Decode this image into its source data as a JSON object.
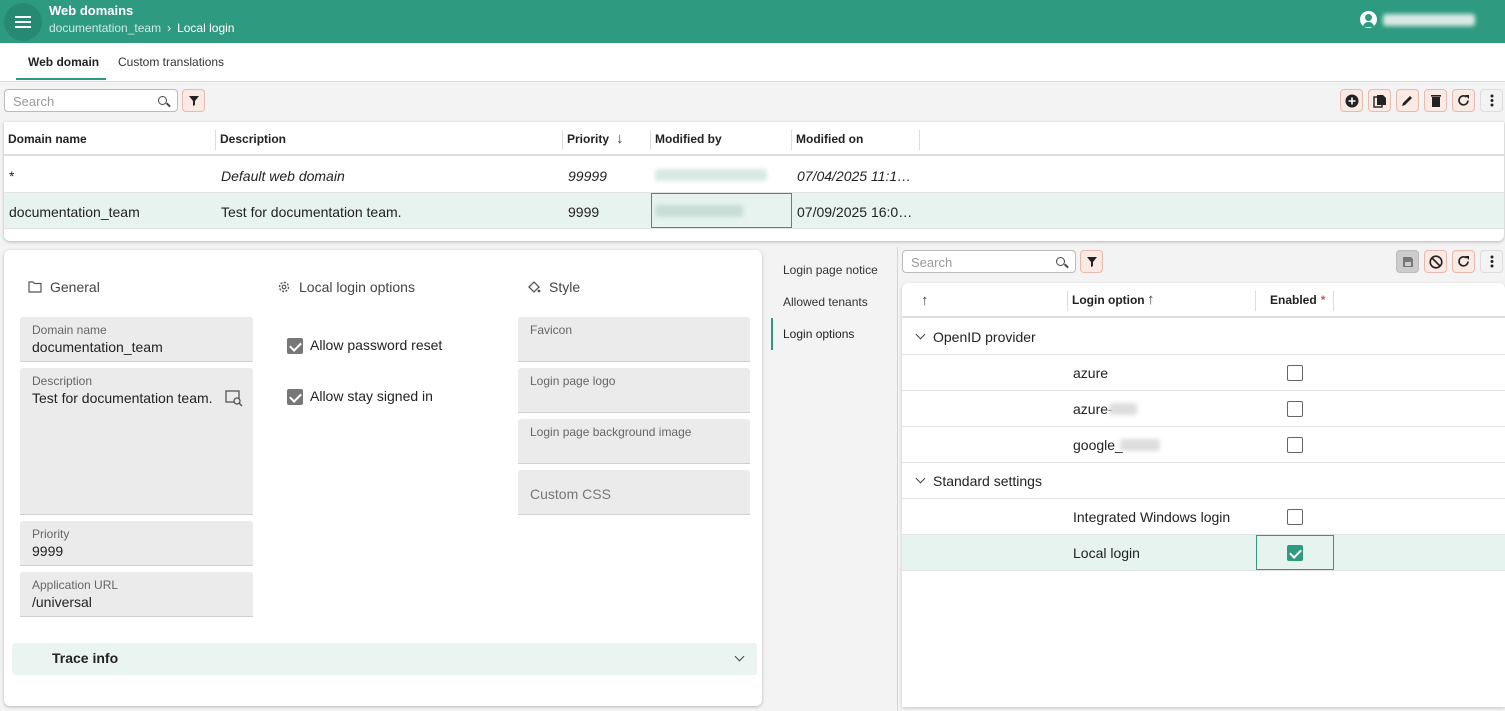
{
  "header": {
    "title": "Web domains",
    "breadcrumb": [
      "documentation_team",
      "Local login"
    ],
    "breadcrumb_sep": "›"
  },
  "tabs": [
    "Web domain",
    "Custom translations"
  ],
  "top_toolbar": {
    "search_placeholder": "Search"
  },
  "table": {
    "columns": [
      "Domain name",
      "Description",
      "Priority",
      "Modified by",
      "Modified on"
    ],
    "sort_arrow": "↓",
    "rows": [
      {
        "domain": "*",
        "description": "Default web domain",
        "priority": "99999",
        "modified_on": "07/04/2025 11:1…"
      },
      {
        "domain": "documentation_team",
        "description": "Test for documentation team.",
        "priority": "9999",
        "modified_on": "07/09/2025 16:0…"
      }
    ]
  },
  "form": {
    "general_title": "General",
    "local_login_title": "Local login options",
    "style_title": "Style",
    "domain_name_label": "Domain name",
    "domain_name_value": "documentation_team",
    "description_label": "Description",
    "description_value": "Test for documentation team.",
    "priority_label": "Priority",
    "priority_value": "9999",
    "app_url_label": "Application URL",
    "app_url_value": "/universal",
    "allow_password_reset": "Allow password reset",
    "allow_stay_signed_in": "Allow stay signed in",
    "favicon_label": "Favicon",
    "login_logo_label": "Login page logo",
    "login_bg_label": "Login page background image",
    "custom_css_label": "Custom CSS",
    "trace_info": "Trace info"
  },
  "sidenav": [
    "Login page notice",
    "Allowed tenants",
    "Login options"
  ],
  "right_toolbar": {
    "search_placeholder": "Search"
  },
  "tree": {
    "columns": [
      "Login option",
      "Enabled"
    ],
    "required_mark": "*",
    "groups": [
      {
        "name": "OpenID provider",
        "items": [
          "azure",
          "azure-",
          "google_"
        ]
      },
      {
        "name": "Standard settings",
        "items": [
          "Integrated Windows login",
          "Local login"
        ]
      }
    ]
  },
  "colors": {
    "accent": "#2e9b80",
    "selection": "#e6f3ef"
  }
}
